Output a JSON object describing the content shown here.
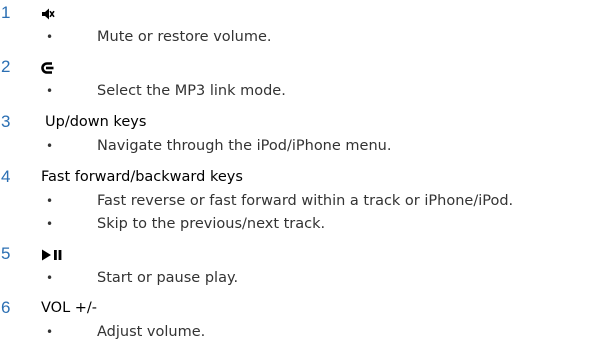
{
  "items": [
    {
      "number": "1",
      "icon": "mute-icon",
      "bullets": [
        "Mute or restore volume."
      ]
    },
    {
      "number": "2",
      "icon": "mp3-link-icon",
      "bullets": [
        "Select the MP3 link mode."
      ]
    },
    {
      "number": "3",
      "label": "Up/down keys",
      "bullets": [
        "Navigate through the iPod/iPhone menu."
      ]
    },
    {
      "number": "4",
      "label": "Fast forward/backward keys",
      "bullets": [
        "Fast reverse or fast forward within a track or iPhone/iPod.",
        "Skip to the previous/next track."
      ]
    },
    {
      "number": "5",
      "icon": "play-pause-icon",
      "bullets": [
        "Start or pause play."
      ]
    },
    {
      "number": "6",
      "label": "VOL +/-",
      "bullets": [
        "Adjust volume."
      ]
    }
  ],
  "bullet_glyph": "•",
  "colors": {
    "number": "#2b6fb3",
    "heading": "#000000",
    "bullet_text": "#333333"
  }
}
